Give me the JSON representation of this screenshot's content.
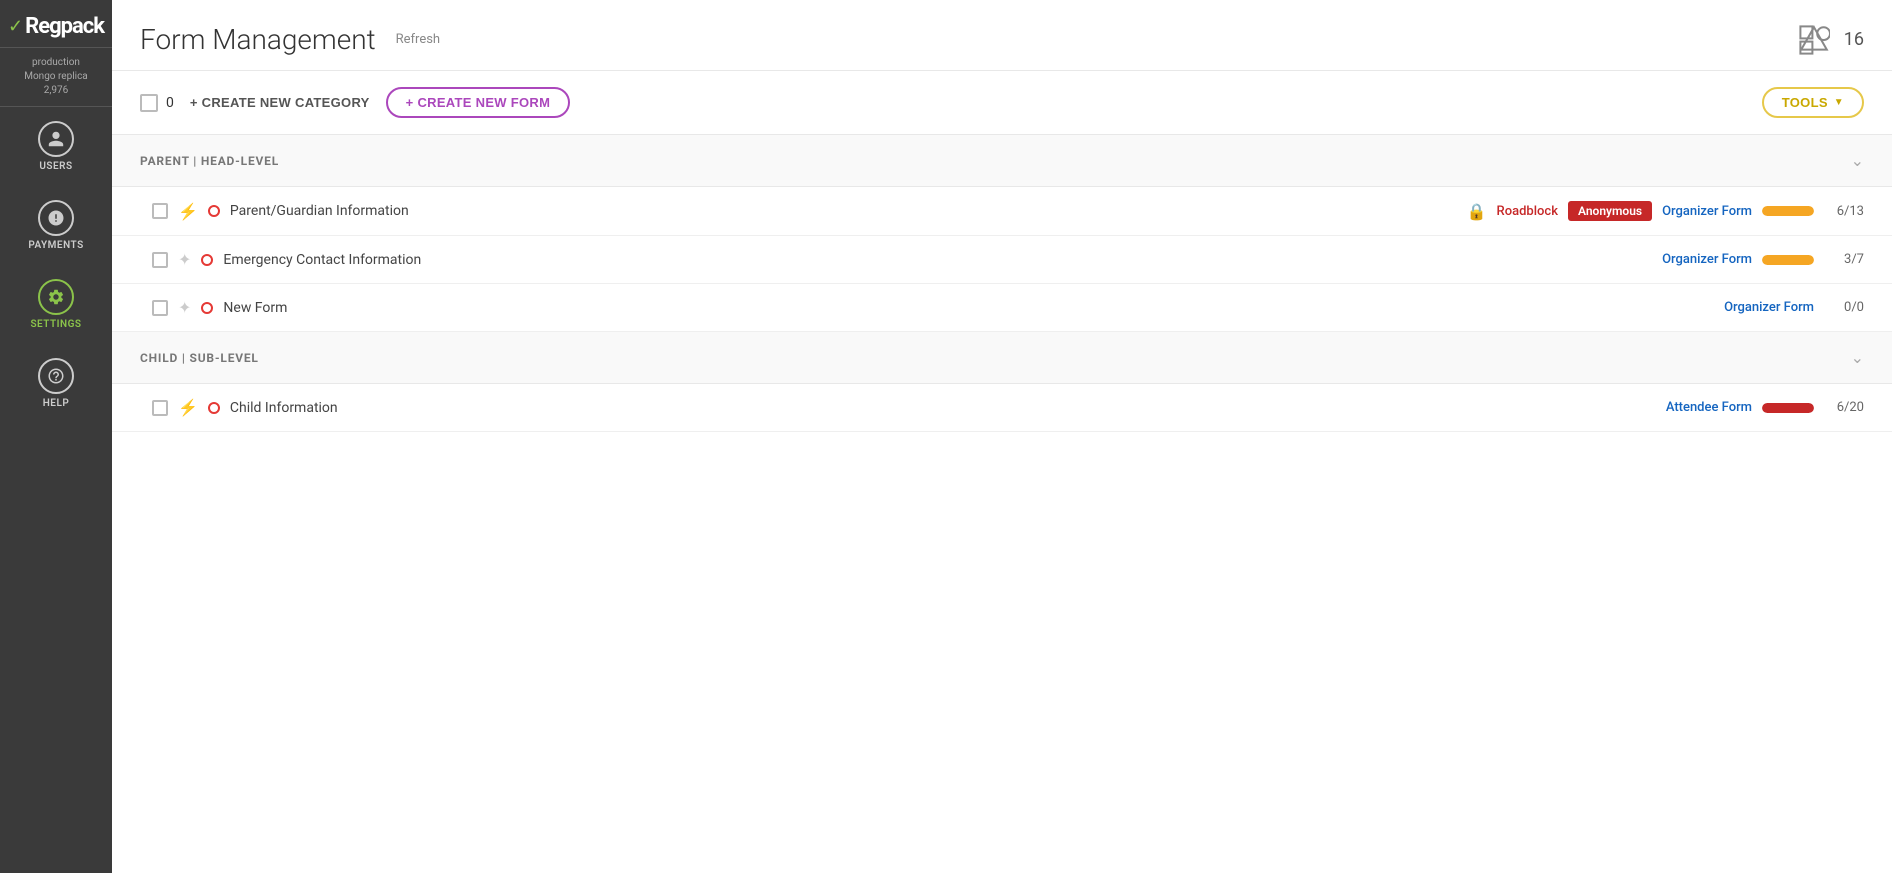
{
  "sidebar": {
    "logo": "Regpack",
    "info_line1": "production",
    "info_line2": "Mongo replica",
    "info_line3": "2,976",
    "nav_items": [
      {
        "id": "users",
        "label": "USERS",
        "icon": "person",
        "active": false
      },
      {
        "id": "payments",
        "label": "PAYMENTS",
        "icon": "coins",
        "active": false
      },
      {
        "id": "settings",
        "label": "SETTINGS",
        "icon": "gear",
        "active": true
      },
      {
        "id": "help",
        "label": "HELP",
        "icon": "question",
        "active": false
      }
    ]
  },
  "header": {
    "title": "Form Management",
    "refresh_label": "Refresh",
    "badge_count": "16"
  },
  "toolbar": {
    "select_count": "0",
    "create_category_label": "+ CREATE NEW CATEGORY",
    "create_form_label": "+ CREATE NEW FORM",
    "tools_label": "TOOLS"
  },
  "sections": [
    {
      "id": "parent",
      "title": "PARENT | HEAD-LEVEL",
      "forms": [
        {
          "id": "parent-guardian",
          "name": "Parent/Guardian Information",
          "lightning": true,
          "roadblock": true,
          "roadblock_label": "Roadblock",
          "anonymous": true,
          "anonymous_label": "Anonymous",
          "form_type": "Organizer Form",
          "progress": "yellow",
          "count": "6/13"
        },
        {
          "id": "emergency-contact",
          "name": "Emergency Contact Information",
          "lightning": false,
          "roadblock": false,
          "anonymous": false,
          "form_type": "Organizer Form",
          "progress": "yellow",
          "count": "3/7"
        },
        {
          "id": "new-form",
          "name": "New Form",
          "lightning": false,
          "roadblock": false,
          "anonymous": false,
          "form_type": "Organizer Form",
          "progress": null,
          "count": "0/0"
        }
      ]
    },
    {
      "id": "child",
      "title": "CHILD | SUB-LEVEL",
      "forms": [
        {
          "id": "child-information",
          "name": "Child Information",
          "lightning": true,
          "roadblock": false,
          "anonymous": false,
          "form_type": "Attendee Form",
          "progress": "red",
          "count": "6/20"
        }
      ]
    }
  ]
}
